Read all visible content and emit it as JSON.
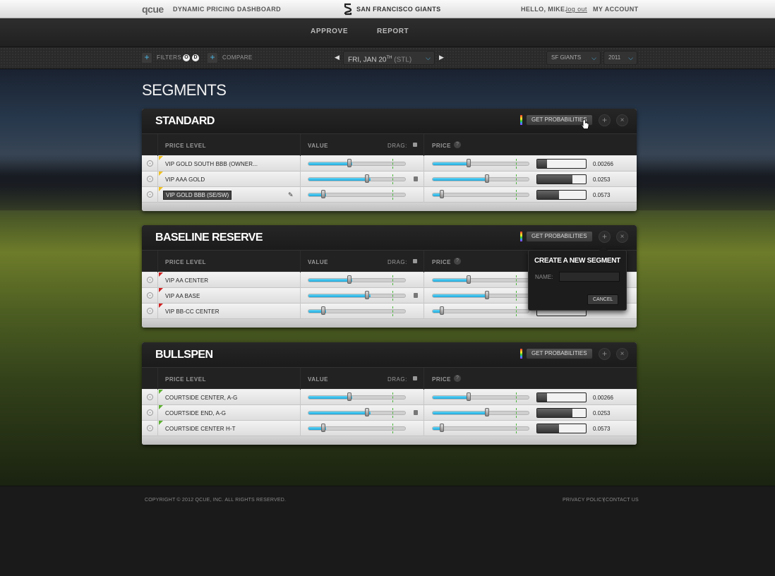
{
  "topbar": {
    "logo": "qcue",
    "app_title": "DYNAMIC PRICING DASHBOARD",
    "team_name": "SAN FRANCISCO GIANTS",
    "greeting": "HELLO, MIKE.",
    "logout": "log out",
    "account": "MY ACCOUNT"
  },
  "nav": {
    "approve": "APPROVE",
    "report": "REPORT"
  },
  "filters": {
    "filters_label": "FILTERS",
    "filter_o": "O",
    "filter_d": "D",
    "compare_label": "COMPARE",
    "date_main": "FRI, JAN 20",
    "date_sup": "TH",
    "date_opp": "(STL)",
    "team_select": "SF GIANTS",
    "year_select": "2011"
  },
  "page_title": "SEGMENTS",
  "column_headers": {
    "price_level": "PRICE LEVEL",
    "value": "VALUE",
    "drag": "DRAG:",
    "price": "PRICE"
  },
  "get_probabilities": "GET PROBABILITIES",
  "segments": [
    {
      "title": "STANDARD",
      "rows": [
        {
          "name": "VIP GOLD SOUTH BBB (OWNER...",
          "value_pct": 45,
          "price_pct": 40,
          "prob": "0.00266",
          "prob_fill": 20,
          "locked": false,
          "flag": "#f0c020"
        },
        {
          "name": "VIP AAA GOLD",
          "value_pct": 64,
          "price_pct": 59,
          "prob": "0.0253",
          "prob_fill": 72,
          "locked": true,
          "flag": "#f0c020"
        },
        {
          "name": "VIP GOLD BBB (SE/SW)",
          "value_pct": 18,
          "price_pct": 12,
          "prob": "0.0573",
          "prob_fill": 45,
          "locked": false,
          "flag": "#f0c020"
        }
      ]
    },
    {
      "title": "BASELINE RESERVE",
      "rows": [
        {
          "name": "VIP AA CENTER",
          "value_pct": 45,
          "price_pct": 40,
          "prob": "",
          "prob_fill": 0,
          "locked": false,
          "flag": "#d02020"
        },
        {
          "name": "VIP AA BASE",
          "value_pct": 64,
          "price_pct": 59,
          "prob": "",
          "prob_fill": 0,
          "locked": true,
          "flag": "#d02020"
        },
        {
          "name": "VIP BB-CC CENTER",
          "value_pct": 18,
          "price_pct": 12,
          "prob": "",
          "prob_fill": 0,
          "locked": false,
          "flag": "#d02020"
        }
      ]
    },
    {
      "title": "BULLSPEN",
      "rows": [
        {
          "name": "COURTSIDE CENTER, A-G",
          "value_pct": 45,
          "price_pct": 40,
          "prob": "0.00266",
          "prob_fill": 20,
          "locked": false,
          "flag": "#5cb030"
        },
        {
          "name": "COURTSIDE END, A-G",
          "value_pct": 64,
          "price_pct": 59,
          "prob": "0.0253",
          "prob_fill": 72,
          "locked": true,
          "flag": "#5cb030"
        },
        {
          "name": "COURTSIDE CENTER H-T",
          "value_pct": 18,
          "price_pct": 12,
          "prob": "0.0573",
          "prob_fill": 45,
          "locked": false,
          "flag": "#5cb030"
        }
      ]
    }
  ],
  "tooltip": "VIP GOLD BBB (SE/SW)",
  "popover": {
    "title": "CREATE A NEW SEGMENT",
    "name_label": "NAME:",
    "cancel": "CANCEL"
  },
  "footer": {
    "copyright": "COPYRIGHT © 2012 QCUE, INC. ALL RIGHTS RESERVED.",
    "privacy": "PRIVACY POLICY",
    "divider": "|",
    "contact": "CONTACT US"
  },
  "colors": {
    "accent": "#1ca8dc",
    "target": "#4ab43a"
  }
}
